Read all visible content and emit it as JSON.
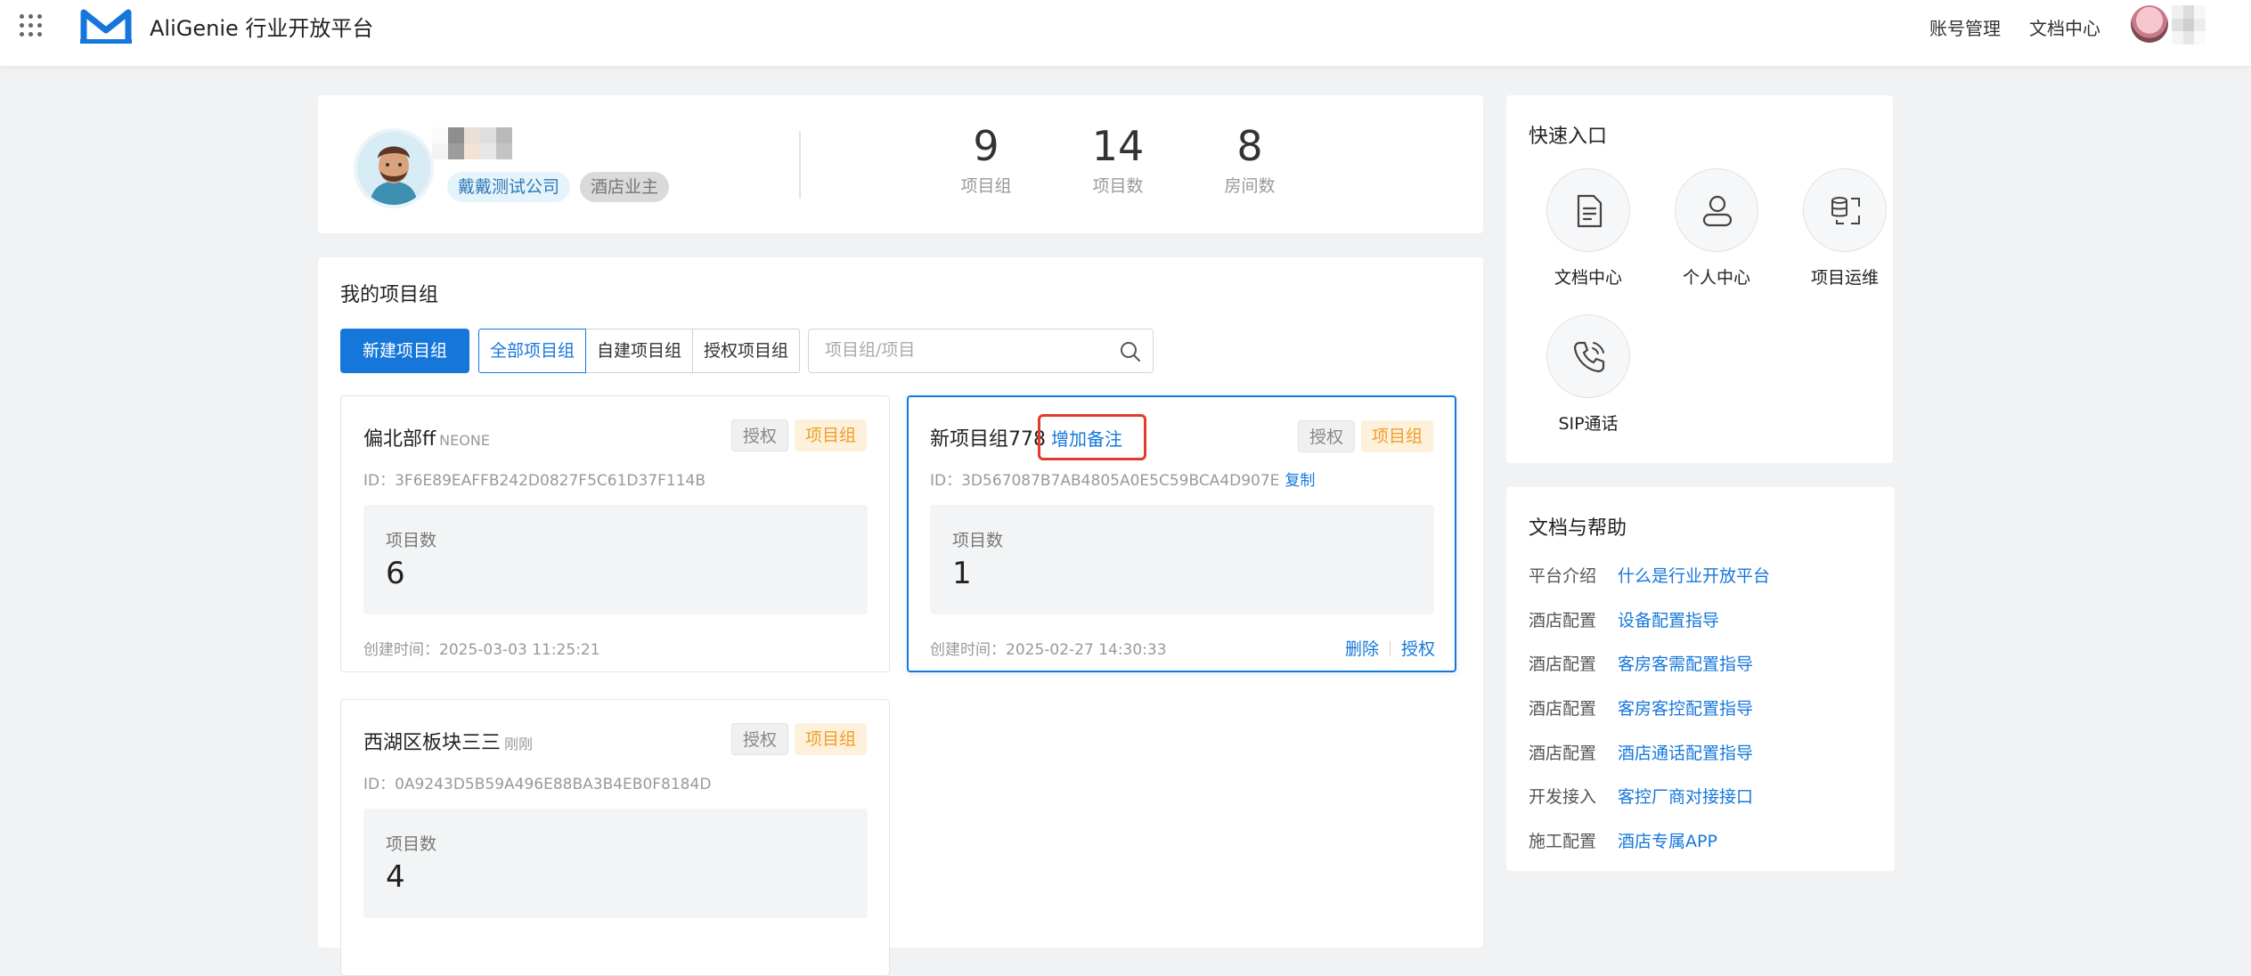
{
  "header": {
    "app_title": "AliGenie 行业开放平台",
    "links": [
      "账号管理",
      "文档中心"
    ],
    "brand_color": "#1677db"
  },
  "profile": {
    "company_tag": "戴戴测试公司",
    "role_tag": "酒店业主",
    "stats": [
      {
        "value": "9",
        "label": "项目组"
      },
      {
        "value": "14",
        "label": "项目数"
      },
      {
        "value": "8",
        "label": "房间数"
      }
    ]
  },
  "projects": {
    "title": "我的项目组",
    "new_button": "新建项目组",
    "filters": [
      "全部项目组",
      "自建项目组",
      "授权项目组"
    ],
    "search_placeholder": "项目组/项目",
    "cards": [
      {
        "name": "偏北部ff",
        "sub": "NEONE",
        "note_link": "",
        "badges": [
          "授权",
          "项目组"
        ],
        "id_label": "ID：",
        "id": "3F6E89EAFFB242D0827F5C61D37F114B",
        "copy": "",
        "count_label": "项目数",
        "count": "6",
        "created_label": "创建时间：",
        "created": "2025-03-03 11:25:21",
        "actions": []
      },
      {
        "name": "新项目组778",
        "sub": "",
        "note_link": "增加备注",
        "badges": [
          "授权",
          "项目组"
        ],
        "id_label": "ID：",
        "id": "3D567087B7AB4805A0E5C59BCA4D907E",
        "copy": "复制",
        "count_label": "项目数",
        "count": "1",
        "created_label": "创建时间：",
        "created": "2025-02-27 14:30:33",
        "actions": [
          "删除",
          "授权"
        ]
      },
      {
        "name": "西湖区板块三三",
        "sub": "刚刚",
        "note_link": "",
        "badges": [
          "授权",
          "项目组"
        ],
        "id_label": "ID：",
        "id": "0A9243D5B59A496E88BA3B4EB0F8184D",
        "copy": "",
        "count_label": "项目数",
        "count": "4",
        "created_label": "",
        "created": "",
        "actions": []
      }
    ]
  },
  "quick": {
    "title": "快速入口",
    "items": [
      {
        "label": "文档中心",
        "icon": "document-icon"
      },
      {
        "label": "个人中心",
        "icon": "user-icon"
      },
      {
        "label": "项目运维",
        "icon": "ops-icon"
      },
      {
        "label": "SIP通话",
        "icon": "phone-icon"
      }
    ]
  },
  "docs": {
    "title": "文档与帮助",
    "rows": [
      {
        "category": "平台介绍",
        "link": "什么是行业开放平台"
      },
      {
        "category": "酒店配置",
        "link": "设备配置指导"
      },
      {
        "category": "酒店配置",
        "link": "客房客需配置指导"
      },
      {
        "category": "酒店配置",
        "link": "客房客控配置指导"
      },
      {
        "category": "酒店配置",
        "link": "酒店通话配置指导"
      },
      {
        "category": "开发接入",
        "link": "客控厂商对接接口"
      },
      {
        "category": "施工配置",
        "link": "酒店专属APP"
      }
    ]
  }
}
